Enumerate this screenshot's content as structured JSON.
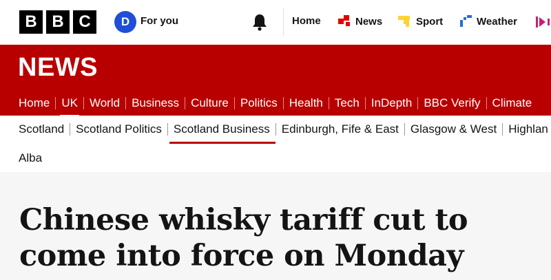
{
  "header": {
    "logo_letters": [
      "B",
      "B",
      "C"
    ],
    "avatar_letter": "D",
    "for_you_label": "For you",
    "nav": [
      {
        "label": "Home",
        "icon": "home"
      },
      {
        "label": "News",
        "icon": "news-icon",
        "color": "#e60000"
      },
      {
        "label": "Sport",
        "icon": "sport-icon",
        "color": "#ffd230"
      },
      {
        "label": "Weather",
        "icon": "weather-icon",
        "color": "#1e6fe0"
      }
    ]
  },
  "news_band": {
    "title": "NEWS",
    "color": "#b80000",
    "nav": [
      "Home",
      "UK",
      "World",
      "Business",
      "Culture",
      "Politics",
      "Health",
      "Tech",
      "InDepth",
      "BBC Verify",
      "Climate"
    ],
    "active": "UK"
  },
  "secondary_nav": {
    "items": [
      "Scotland",
      "Scotland Politics",
      "Scotland Business",
      "Edinburgh, Fife & East",
      "Glasgow & West",
      "Highlan"
    ],
    "active": "Scotland Business",
    "second_row": "Alba"
  },
  "article": {
    "headline": "Chinese whisky tariff cut to come into force on Monday"
  }
}
